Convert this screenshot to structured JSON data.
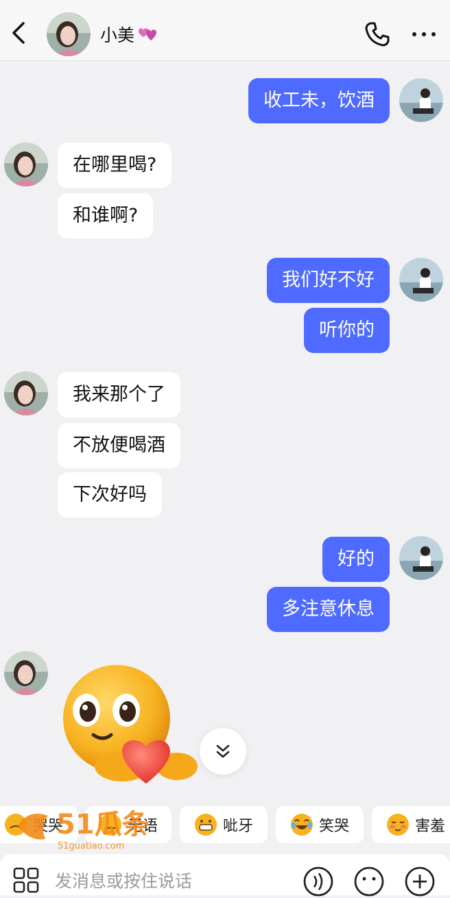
{
  "header": {
    "title": "小美",
    "back_icon": "chevron-left-icon",
    "call_icon": "phone-icon",
    "more_icon": "more-horizontal-icon",
    "title_emoji": "revolving-hearts-icon"
  },
  "messages": [
    {
      "side": "out",
      "text": "收工未，饮酒"
    },
    {
      "side": "in",
      "text": "在哪里喝?"
    },
    {
      "side": "in",
      "text": "和谁啊?"
    },
    {
      "side": "out",
      "text": "我们好不好"
    },
    {
      "side": "out",
      "text": "听你的"
    },
    {
      "side": "in",
      "text": "我来那个了"
    },
    {
      "side": "in",
      "text": "不放便喝酒"
    },
    {
      "side": "in",
      "text": "下次好吗"
    },
    {
      "side": "out",
      "text": "好的"
    },
    {
      "side": "out",
      "text": "多注意休息"
    }
  ],
  "sticker": {
    "name": "heart-emoji-sticker"
  },
  "emoji_suggestions": [
    {
      "label": "哭哭"
    },
    {
      "label": "无语"
    },
    {
      "label": "呲牙"
    },
    {
      "label": "笑哭"
    },
    {
      "label": "害羞"
    }
  ],
  "input": {
    "placeholder": "发消息或按住说话"
  },
  "watermark": {
    "text": "51瓜条",
    "url_text": "51guatiao.com"
  },
  "colors": {
    "outgoing_bubble": "#4f6bff",
    "incoming_bubble": "#ffffff",
    "background": "#f1f1f3"
  }
}
